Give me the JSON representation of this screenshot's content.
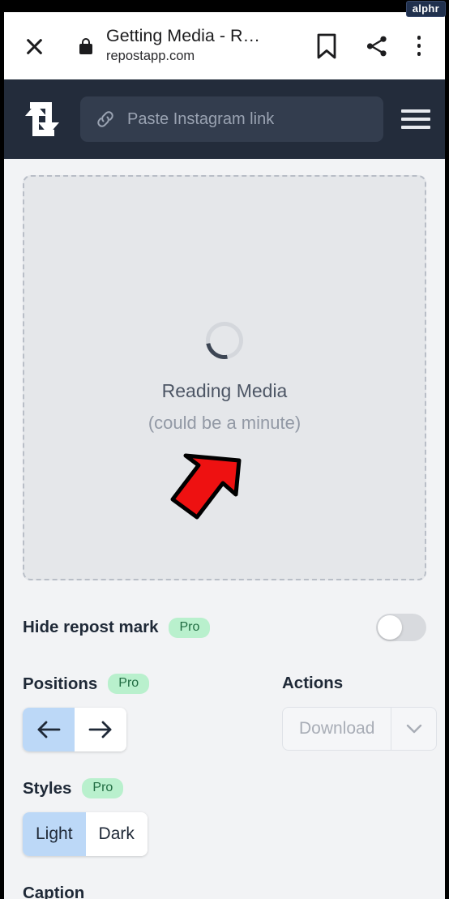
{
  "watermark": {
    "text": "alphr"
  },
  "browser": {
    "close_icon": "close-icon",
    "lock_icon": "lock-icon",
    "page_title": "Getting Media - R…",
    "page_domain": "repostapp.com",
    "bookmark_icon": "bookmark-icon",
    "share_icon": "share-icon",
    "overflow_icon": "more-vertical-icon"
  },
  "app_header": {
    "logo_icon": "repost-logo-icon",
    "link_icon": "link-icon",
    "link_placeholder": "Paste Instagram link",
    "menu_icon": "hamburger-icon"
  },
  "media": {
    "loading_primary": "Reading Media",
    "loading_secondary": "(could be a minute)",
    "annotation_icon": "red-arrow-annotation"
  },
  "settings": {
    "hide_repost_mark": {
      "label": "Hide repost mark",
      "badge": "Pro",
      "toggle_state": "off"
    },
    "positions": {
      "label": "Positions",
      "badge": "Pro",
      "buttons": [
        {
          "icon": "arrow-left-icon",
          "selected": true
        },
        {
          "icon": "arrow-right-icon",
          "selected": false
        }
      ]
    },
    "actions": {
      "label": "Actions",
      "download_label": "Download",
      "caret_icon": "chevron-down-icon",
      "enabled": false
    },
    "styles": {
      "label": "Styles",
      "badge": "Pro",
      "options": [
        {
          "label": "Light",
          "selected": true
        },
        {
          "label": "Dark",
          "selected": false
        }
      ]
    },
    "caption": {
      "label": "Caption"
    }
  },
  "colors": {
    "app_header_bg": "#232c3b",
    "page_bg": "#f2f3f5",
    "pro_badge_bg": "#b9f0cd",
    "pro_badge_text": "#1f6b41",
    "segment_active_bg": "#bcd8f7",
    "annotation_red": "#ee1111"
  }
}
